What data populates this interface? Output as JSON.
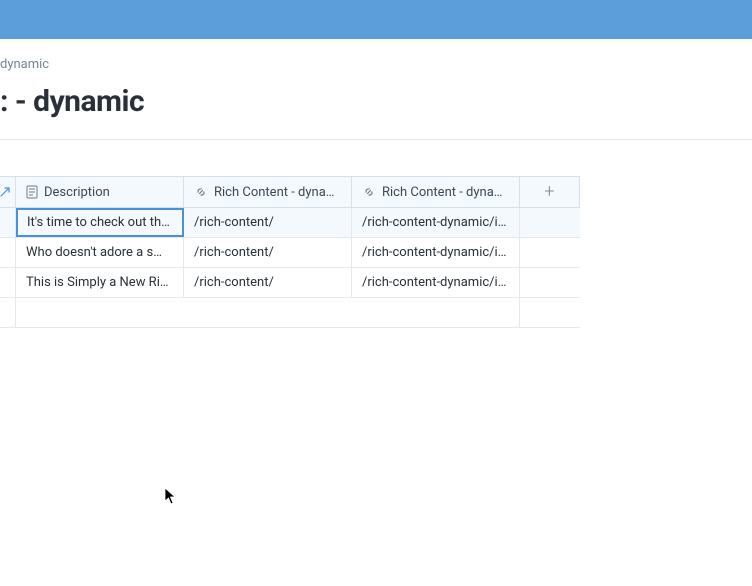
{
  "header": {
    "breadcrumb": "dynamic",
    "title": ": - dynamic"
  },
  "table": {
    "columns": {
      "description": "Description",
      "richContent1": "Rich Content - dynam…",
      "richContent2": "Rich Content - dynam…"
    },
    "rows": [
      {
        "description": "It's time to check out the …",
        "rich1": "/rich-content/",
        "rich2": "/rich-content-dynamic/i-a…",
        "selected": true
      },
      {
        "description": "Who doesn't adore a smili…",
        "rich1": "/rich-content/",
        "rich2": "/rich-content-dynamic/i-a…",
        "selected": false
      },
      {
        "description": "This is Simply a New Rich …",
        "rich1": "/rich-content/",
        "rich2": "/rich-content-dynamic/i-a…",
        "selected": false
      }
    ]
  },
  "icons": {
    "expand": "expand-icon",
    "description": "description-icon",
    "link": "link-icon",
    "plus": "plus-icon"
  }
}
